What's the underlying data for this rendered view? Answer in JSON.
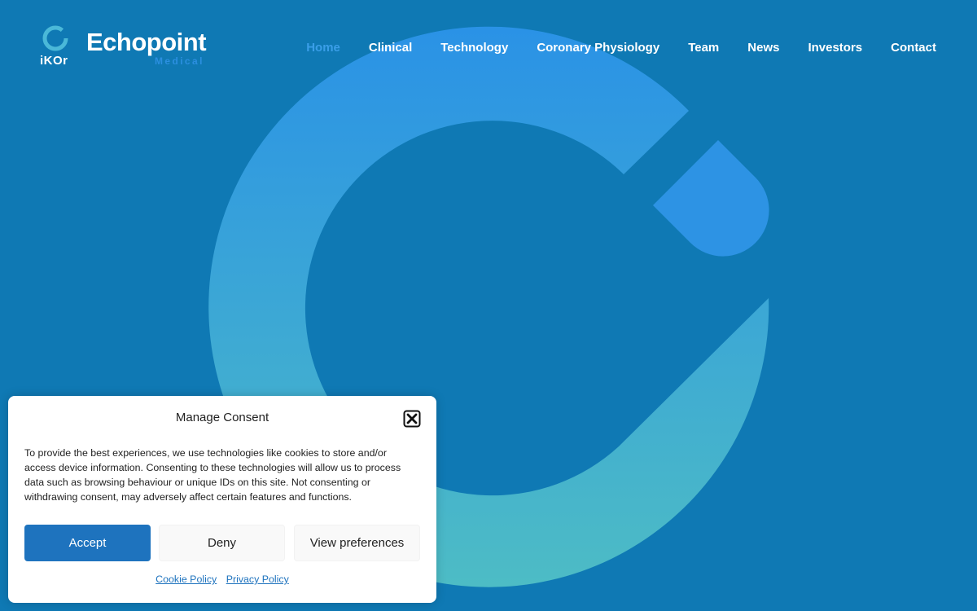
{
  "brand": {
    "ikor_text": "iKOr",
    "echopoint_text": "Echopoint",
    "medical_text": "Medical"
  },
  "nav": {
    "items": [
      {
        "label": "Home",
        "active": true
      },
      {
        "label": "Clinical"
      },
      {
        "label": "Technology"
      },
      {
        "label": "Coronary Physiology"
      },
      {
        "label": "Team"
      },
      {
        "label": "News"
      },
      {
        "label": "Investors"
      },
      {
        "label": "Contact"
      }
    ]
  },
  "consent": {
    "title": "Manage Consent",
    "body": "To provide the best experiences, we use technologies like cookies to store and/or access device information. Consenting to these technologies will allow us to process data such as browsing behaviour or unique IDs on this site. Not consenting or withdrawing consent, may adversely affect certain features and functions.",
    "accept_label": "Accept",
    "deny_label": "Deny",
    "preferences_label": "View preferences",
    "cookie_policy_label": "Cookie Policy",
    "privacy_policy_label": "Privacy Policy"
  },
  "colors": {
    "background": "#0f79b4",
    "accent_blue": "#2b8fe0",
    "accent_teal": "#4ab8c8",
    "button_primary": "#1e73be",
    "nav_active": "#3a9ee8"
  },
  "icons": {
    "close": "close-icon",
    "logo_ring": "ikor-ring-icon",
    "hero": "echopoint-c-mark"
  }
}
